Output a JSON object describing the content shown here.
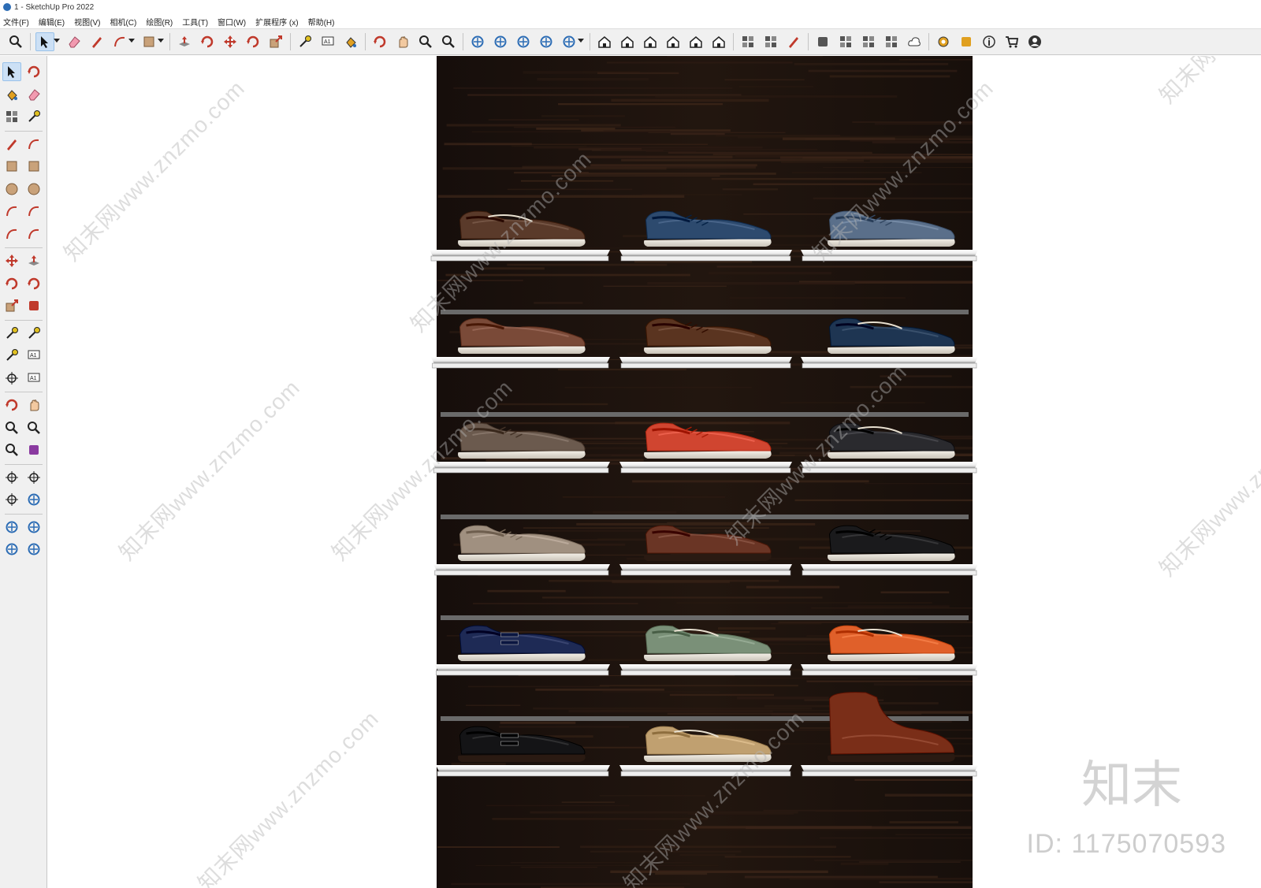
{
  "window": {
    "title": "1 - SketchUp Pro 2022"
  },
  "menu": [
    "文件(F)",
    "编辑(E)",
    "视图(V)",
    "相机(C)",
    "绘图(R)",
    "工具(T)",
    "窗口(W)",
    "扩展程序 (x)",
    "帮助(H)"
  ],
  "toolbar": {
    "icons": [
      "zoom-icon",
      "select-icon",
      "eraser-icon",
      "pencil-line-icon",
      "arc-icon",
      "rectangle-icon",
      "push-pull-icon",
      "follow-me-icon",
      "move-icon",
      "rotate-icon",
      "scale-icon",
      "tape-measure-icon",
      "text-icon",
      "paint-bucket-icon",
      "orbit-icon",
      "pan-icon",
      "zoom-window-icon",
      "zoom-extents-icon",
      "section-plane-icon",
      "section-display-icon",
      "section-fill-icon",
      "section-cut-icon",
      "profile-icon",
      "iso-view-icon",
      "top-view-icon",
      "front-view-icon",
      "right-view-icon",
      "back-view-icon",
      "left-view-icon",
      "component-icon",
      "group-icon",
      "outliner-icon",
      "add-location-icon",
      "warehouse-icon",
      "extension-warehouse-icon",
      "materials-icon",
      "cloud-icon",
      "settings-icon",
      "layout-icon",
      "info-icon",
      "cart-icon",
      "account-icon"
    ]
  },
  "left_toolbar": {
    "icons": [
      "select-icon",
      "orbit-icon",
      "paint-bucket-icon",
      "eraser-icon",
      "component-icon",
      "tape-icon",
      "pencil-icon",
      "freehand-icon",
      "rectangle-icon",
      "rotated-rectangle-icon",
      "circle-icon",
      "polygon-icon",
      "arc-icon",
      "two-point-arc-icon",
      "three-point-arc-icon",
      "pie-icon",
      "move-icon",
      "push-pull-icon",
      "rotate-icon",
      "follow-me-icon",
      "scale-icon",
      "offset-icon",
      "tape-measure-icon",
      "dimension-icon",
      "protractor-icon",
      "text-icon",
      "axes-icon",
      "3d-text-icon",
      "orbit-icon",
      "pan-icon",
      "zoom-icon",
      "zoom-window-icon",
      "zoom-extents-icon",
      "previous-icon",
      "position-camera-icon",
      "look-around-icon",
      "walk-icon",
      "section-plane-icon",
      "section-display-icon",
      "section-fill-icon",
      "section-cut-icon",
      "section-profile-icon"
    ]
  },
  "scene": {
    "colors": {
      "panel": "#1f1512",
      "grain": "#3a2418",
      "shelf": "#f4f4f4",
      "shelf_edge": "#8a8a8a",
      "rail": "#6a6a6a"
    },
    "shoes": [
      {
        "row": 1,
        "col": 1,
        "name": "brown-boat-shoe",
        "color": "#5a3a2a"
      },
      {
        "row": 1,
        "col": 2,
        "name": "blue-suede-sneaker",
        "color": "#2d4a6e"
      },
      {
        "row": 1,
        "col": 3,
        "name": "blue-wingtip-sneaker",
        "color": "#5a6f8a"
      },
      {
        "row": 2,
        "col": 1,
        "name": "brown-loafer",
        "color": "#7a4a38"
      },
      {
        "row": 2,
        "col": 2,
        "name": "brown-suede-derby",
        "color": "#5a3420"
      },
      {
        "row": 2,
        "col": 3,
        "name": "navy-driving-moccasin",
        "color": "#1e3552"
      },
      {
        "row": 3,
        "col": 1,
        "name": "taupe-suede-oxford",
        "color": "#6b5a4e"
      },
      {
        "row": 3,
        "col": 2,
        "name": "red-oxford",
        "color": "#d04530"
      },
      {
        "row": 3,
        "col": 3,
        "name": "black-boat-shoe",
        "color": "#2a2a2e"
      },
      {
        "row": 4,
        "col": 1,
        "name": "grey-suede-brogue",
        "color": "#a09080"
      },
      {
        "row": 4,
        "col": 2,
        "name": "brown-penny-loafer",
        "color": "#6a3525"
      },
      {
        "row": 4,
        "col": 3,
        "name": "black-leather-brogue",
        "color": "#1a1a1c"
      },
      {
        "row": 5,
        "col": 1,
        "name": "navy-double-monk",
        "color": "#1e2a55"
      },
      {
        "row": 5,
        "col": 2,
        "name": "sage-boat-shoe",
        "color": "#7a9078"
      },
      {
        "row": 5,
        "col": 3,
        "name": "orange-driving-moccasin",
        "color": "#e0602a"
      },
      {
        "row": 6,
        "col": 1,
        "name": "black-double-monk",
        "color": "#141416"
      },
      {
        "row": 6,
        "col": 2,
        "name": "tan-boat-shoe",
        "color": "#c0a070"
      },
      {
        "row": 6,
        "col": 3,
        "name": "brown-chukka-boot",
        "color": "#7a2e18"
      }
    ]
  },
  "watermarks": [
    "知末网www.znzmo.com",
    "知末网www.znzmo.com",
    "知末网www.znzmo.com",
    "知末网www.znzmo.com",
    "知末网www.znzmo.com",
    "知末网www.znzmo.com",
    "知末网www.znzmo.com",
    "知末网www.znzmo.com",
    "知末网www.znzmo.com",
    "知末网www.znzmo.com"
  ],
  "brand": {
    "logo": "知末",
    "id": "ID: 1175070593"
  }
}
